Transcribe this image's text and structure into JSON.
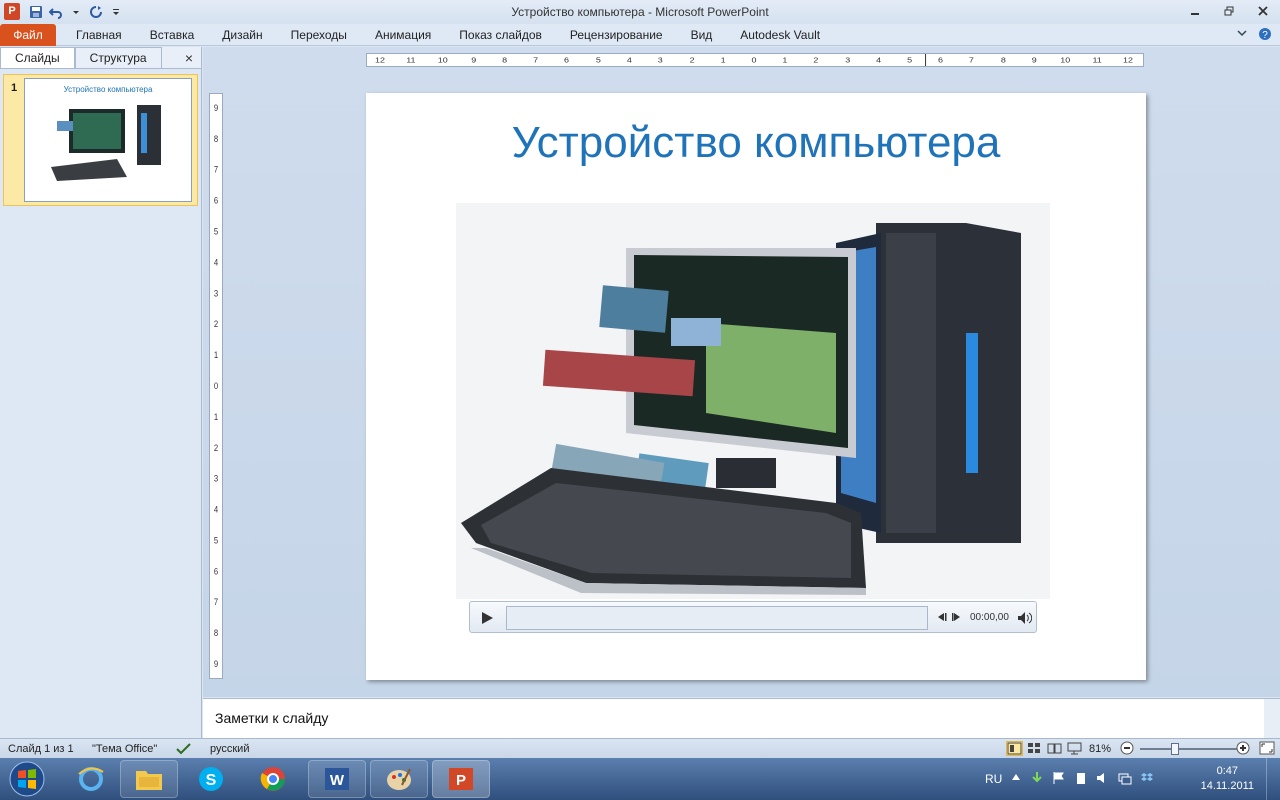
{
  "window": {
    "title": "Устройство компьютера  -  Microsoft PowerPoint",
    "app_icon_letter": "P"
  },
  "ribbon": {
    "file_tab": "Файл",
    "tabs": [
      "Главная",
      "Вставка",
      "Дизайн",
      "Переходы",
      "Анимация",
      "Показ слайдов",
      "Рецензирование",
      "Вид",
      "Autodesk Vault"
    ]
  },
  "left_panel": {
    "tab_slides": "Слайды",
    "tab_outline": "Структура",
    "close": "×",
    "slide_number": "1",
    "thumb_title": "Устройство компьютера"
  },
  "slide": {
    "title": "Устройство компьютера",
    "media_time": "00:00,00"
  },
  "notes": {
    "placeholder": "Заметки к слайду"
  },
  "status_bar": {
    "slide_info": "Слайд 1 из 1",
    "theme": "\"Тема Office\"",
    "language": "русский",
    "zoom": "81%",
    "zoom_level_percent": 81
  },
  "taskbar": {
    "language": "RU",
    "time": "0:47",
    "date": "14.11.2011"
  },
  "colors": {
    "accent": "#1f73b9",
    "file_tab": "#d9511d",
    "taskbar": "#3c5f8f"
  }
}
